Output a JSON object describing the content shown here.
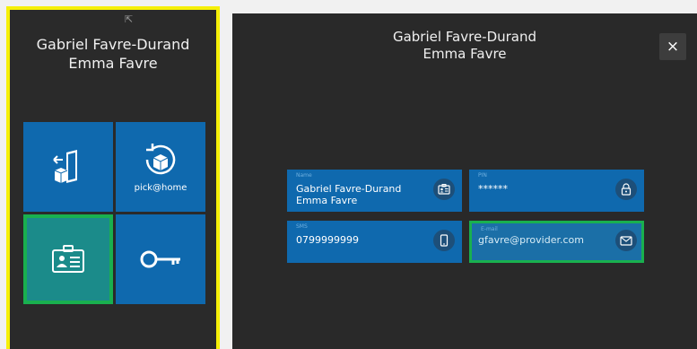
{
  "left_panel": {
    "customer_name": "Gabriel Favre-Durand",
    "customer_name_2": "Emma Favre",
    "tiles": [
      {
        "name": "return-parcel",
        "label": ""
      },
      {
        "name": "pick-at-home",
        "label": "pick@home"
      },
      {
        "name": "identity-card",
        "label": ""
      },
      {
        "name": "key",
        "label": ""
      }
    ],
    "selected_tile": "identity-card"
  },
  "detail_panel": {
    "customer_name": "Gabriel Favre-Durand",
    "customer_name_2": "Emma Favre",
    "close_icon": "×",
    "fields": {
      "name": {
        "label": "Name",
        "value": "Gabriel Favre-Durand",
        "value_2": "Emma Favre",
        "icon": "id-card-icon"
      },
      "pin": {
        "label": "PIN",
        "value": "******",
        "icon": "lock-icon"
      },
      "sms": {
        "label": "SMS",
        "value": "0799999999",
        "icon": "phone-icon"
      },
      "email": {
        "label": "E-mail",
        "value": "gfavre@provider.com",
        "icon": "envelope-icon"
      }
    }
  },
  "colors": {
    "highlight_border": "#f6f007",
    "tile_blue": "#0f69ae",
    "selected_green": "#19b04f",
    "panel_bg": "#2a2a2a"
  }
}
